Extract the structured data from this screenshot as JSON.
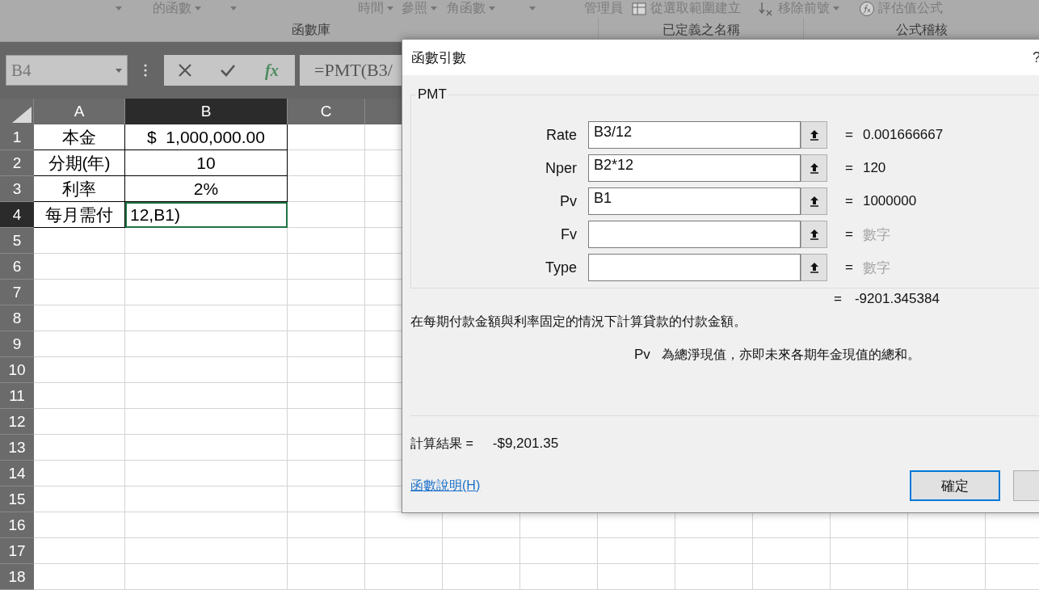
{
  "ribbon": {
    "items": [
      {
        "dropdown": true
      },
      {
        "label": "的函數",
        "dropdown": true
      },
      {
        "dropdown": true
      },
      {
        "label": "時間",
        "dropdown": true
      },
      {
        "label": "參照",
        "dropdown": true
      },
      {
        "label": "角函數",
        "dropdown": true
      },
      {
        "dropdown": true
      },
      {
        "label": "管理員",
        "dropdown": false
      },
      {
        "label": "從選取範圍建立",
        "kind": "table",
        "dropdown": false
      },
      {
        "label": "移除前號",
        "kind": "trace",
        "dropdown": true
      },
      {
        "label": "評估值公式",
        "kind": "evaluate",
        "dropdown": false
      }
    ],
    "groups": [
      {
        "label": "函數庫"
      },
      {
        "label": "已定義之名稱"
      },
      {
        "label": "公式稽核"
      }
    ]
  },
  "name_box": {
    "value": "B4"
  },
  "formula_bar": {
    "function_button": "fx",
    "value": "=PMT(B3/"
  },
  "sheet": {
    "columns": [
      {
        "label": "A",
        "selected": false
      },
      {
        "label": "B",
        "selected": true
      },
      {
        "label": "C",
        "selected": false
      }
    ],
    "rows": [
      {
        "header": "1",
        "selected": false,
        "cells": [
          "本金",
          "$  1,000,000.00"
        ]
      },
      {
        "header": "2",
        "selected": false,
        "cells": [
          "分期(年)",
          "10"
        ]
      },
      {
        "header": "3",
        "selected": false,
        "cells": [
          "利率",
          "2%"
        ]
      },
      {
        "header": "4",
        "selected": true,
        "cells": [
          "每月需付",
          "12,B1)"
        ]
      },
      {
        "header": "5",
        "selected": false
      },
      {
        "header": "6",
        "selected": false
      },
      {
        "header": "7",
        "selected": false
      },
      {
        "header": "8",
        "selected": false
      },
      {
        "header": "9",
        "selected": false
      },
      {
        "header": "10",
        "selected": false
      },
      {
        "header": "11",
        "selected": false
      },
      {
        "header": "12",
        "selected": false
      },
      {
        "header": "13",
        "selected": false
      },
      {
        "header": "14",
        "selected": false
      },
      {
        "header": "15",
        "selected": false
      },
      {
        "header": "16",
        "selected": false
      },
      {
        "header": "17",
        "selected": false
      },
      {
        "header": "18",
        "selected": false
      }
    ]
  },
  "dialog": {
    "title": "函數引數",
    "help": "?",
    "function_name": "PMT",
    "arguments": [
      {
        "label": "Rate",
        "value": "B3/12",
        "equals": "=",
        "result": "0.001666667",
        "muted": false
      },
      {
        "label": "Nper",
        "value": "B2*12",
        "equals": "=",
        "result": "120",
        "muted": false
      },
      {
        "label": "Pv",
        "value": "B1",
        "equals": "=",
        "result": "1000000",
        "muted": false
      },
      {
        "label": "Fv",
        "equals": "=",
        "result": "數字",
        "muted": true
      },
      {
        "label": "Type",
        "equals": "=",
        "result": "數字",
        "muted": true
      }
    ],
    "formula_result": {
      "equals": "=",
      "value": "-9201.345384"
    },
    "description": "在每期付款金額與利率固定的情況下計算貸款的付款金額。",
    "argument_help": {
      "name": "Pv",
      "text": "為總淨現值，亦即未來各期年金現值的總和。"
    },
    "result_label": "計算結果 =",
    "result_value": "-$9,201.35",
    "help_link": "函數說明(H)",
    "buttons": [
      {
        "label": "確定",
        "default": true
      },
      {
        "default": false
      }
    ]
  }
}
